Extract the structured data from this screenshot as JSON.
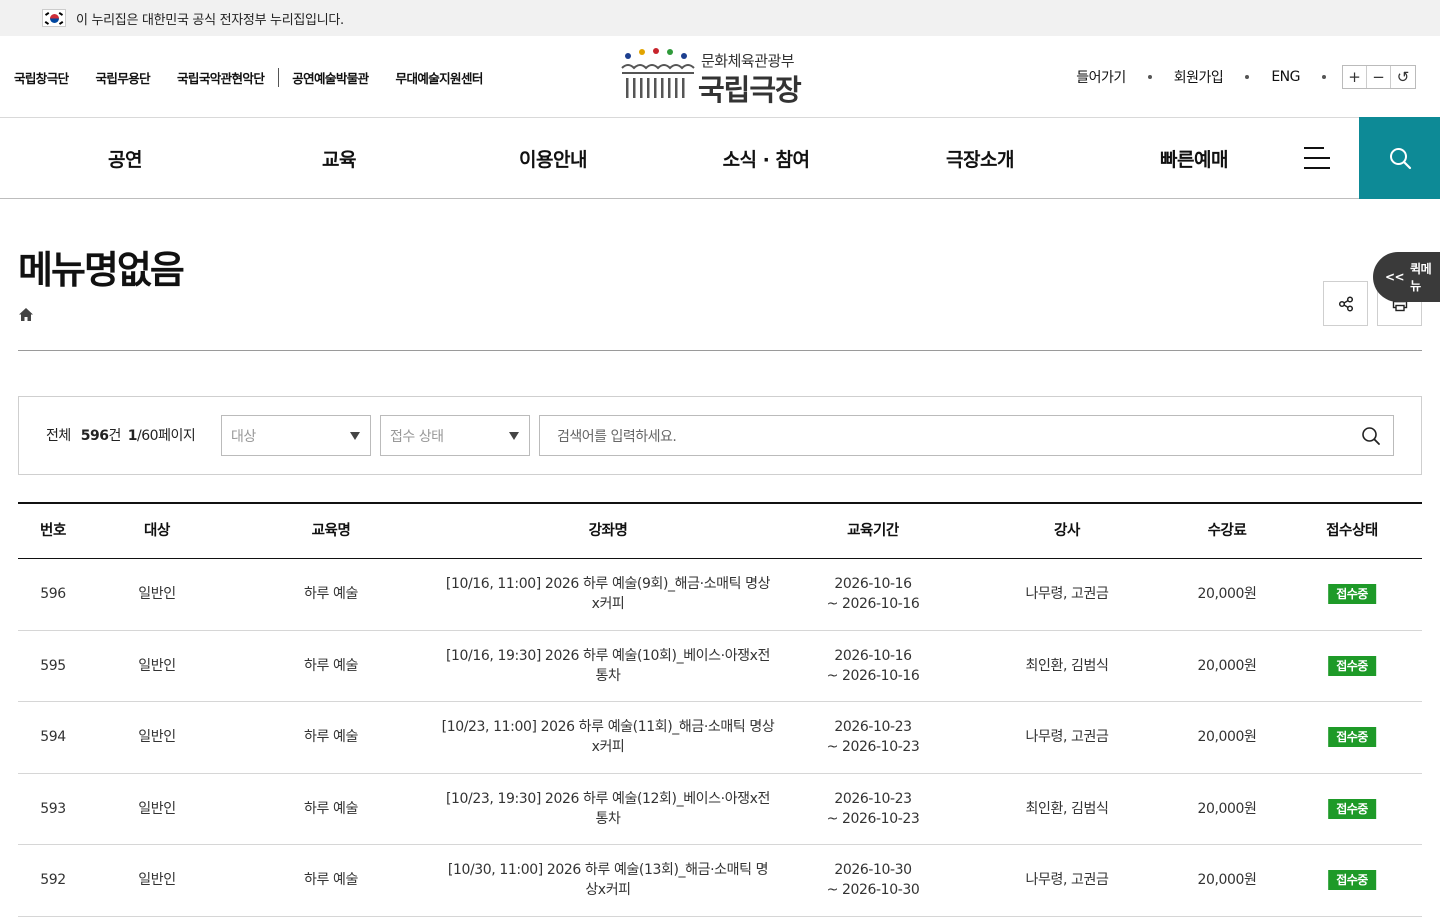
{
  "gov_banner": {
    "text": "이 누리집은 대한민국 공식 전자정부 누리집입니다."
  },
  "family_sites": [
    "국립창극단",
    "국립무용단",
    "국립국악관현악단",
    "공연예술박물관",
    "무대예술지원센터"
  ],
  "logo": {
    "ministry": "문화체육관광부",
    "name": "국립극장"
  },
  "user_links": {
    "login": "들어가기",
    "join": "회원가입",
    "lang": "ENG"
  },
  "zoom": {
    "in": "+",
    "out": "−",
    "reset": "↺"
  },
  "gnb": [
    "공연",
    "교육",
    "이용안내",
    "소식 · 참여",
    "극장소개",
    "빠른예매"
  ],
  "page": {
    "title": "메뉴명없음"
  },
  "quick_menu": {
    "label": "퀵메뉴"
  },
  "filter": {
    "total_label": "전체",
    "total_count": "596",
    "count_unit": "건",
    "current_page": "1",
    "page_suffix": "/60페이지",
    "target_placeholder": "대상",
    "status_placeholder": "접수 상태",
    "search_placeholder": "검색어를 입력하세요."
  },
  "table": {
    "headers": [
      "번호",
      "대상",
      "교육명",
      "강좌명",
      "교육기간",
      "강사",
      "수강료",
      "접수상태"
    ],
    "rows": [
      {
        "no": "596",
        "target": "일반인",
        "edu": "하루 예술",
        "course1": "[10/16, 11:00] 2026 하루 예술(9회)_해금·소매틱 명상",
        "course2": "x커피",
        "period1": "2026-10-16",
        "period2": "~ 2026-10-16",
        "instructor": "나무령, 고권금",
        "fee": "20,000원",
        "status": "접수중"
      },
      {
        "no": "595",
        "target": "일반인",
        "edu": "하루 예술",
        "course1": "[10/16, 19:30] 2026 하루 예술(10회)_베이스·아쟁x전",
        "course2": "통차",
        "period1": "2026-10-16",
        "period2": "~ 2026-10-16",
        "instructor": "최인환, 김범식",
        "fee": "20,000원",
        "status": "접수중"
      },
      {
        "no": "594",
        "target": "일반인",
        "edu": "하루 예술",
        "course1": "[10/23, 11:00] 2026 하루 예술(11회)_해금·소매틱 명상",
        "course2": "x커피",
        "period1": "2026-10-23",
        "period2": "~ 2026-10-23",
        "instructor": "나무령, 고권금",
        "fee": "20,000원",
        "status": "접수중"
      },
      {
        "no": "593",
        "target": "일반인",
        "edu": "하루 예술",
        "course1": "[10/23, 19:30] 2026 하루 예술(12회)_베이스·아쟁x전",
        "course2": "통차",
        "period1": "2026-10-23",
        "period2": "~ 2026-10-23",
        "instructor": "최인환, 김범식",
        "fee": "20,000원",
        "status": "접수중"
      },
      {
        "no": "592",
        "target": "일반인",
        "edu": "하루 예술",
        "course1": "[10/30, 11:00] 2026 하루 예술(13회)_해금·소매틱 명",
        "course2": "상x커피",
        "period1": "2026-10-30",
        "period2": "~ 2026-10-30",
        "instructor": "나무령, 고권금",
        "fee": "20,000원",
        "status": "접수중"
      }
    ]
  }
}
